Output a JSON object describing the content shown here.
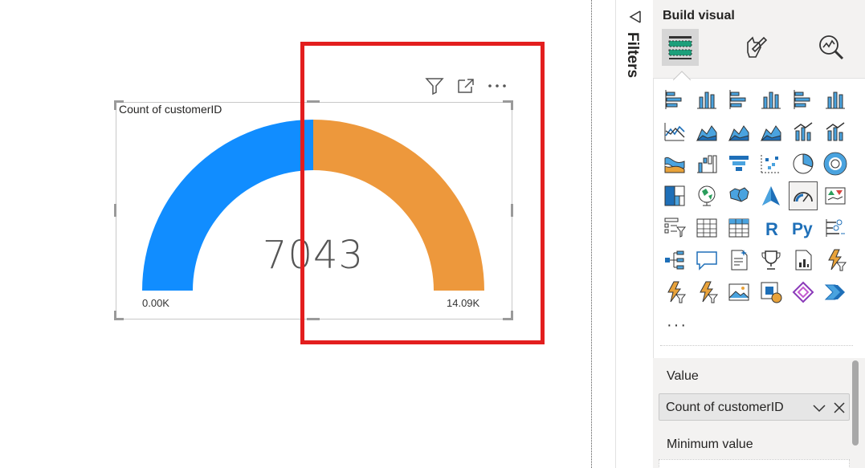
{
  "visual": {
    "title": "Count of customerID",
    "value": "7043",
    "min_label": "0.00K",
    "max_label": "14.09K",
    "value_fraction": 0.5,
    "fill_color": "#118dff",
    "target_color": "#ed983c"
  },
  "visual_header": {
    "icons": [
      "filter-icon",
      "focus-mode-icon",
      "more-options-icon"
    ],
    "more_label": "···"
  },
  "highlight_color": "#e31e1e",
  "filters_pane": {
    "label": "Filters"
  },
  "build_pane": {
    "title": "Build visual",
    "tabs": [
      "build-visual-tab",
      "format-visual-tab",
      "analytics-tab"
    ],
    "more_label": "···",
    "gallery": [
      "stacked-bar-chart",
      "stacked-column-chart",
      "clustered-bar-chart",
      "clustered-column-chart",
      "100-stacked-bar-chart",
      "100-stacked-column-chart",
      "line-chart",
      "area-chart",
      "stacked-area-chart",
      "100-stacked-area-chart",
      "line-and-stacked-column-chart",
      "line-and-clustered-column-chart",
      "ribbon-chart",
      "waterfall-chart",
      "funnel",
      "scatter-chart",
      "pie-chart",
      "donut-chart",
      "treemap",
      "map",
      "filled-map",
      "azure-map",
      "gauge",
      "kpi",
      "slicer",
      "table",
      "matrix",
      "r-script-visual",
      "python-visual",
      "key-influencers",
      "decomposition-tree",
      "qa",
      "smart-narrative",
      "metrics",
      "paginated-report",
      "power-automate",
      "power-apps",
      "power-automate-flow",
      "image-visual",
      "custom-visual",
      "power-apps-visual",
      "power-automate-visual"
    ],
    "selected_gallery_item": "gauge",
    "wells": {
      "value_label": "Value",
      "value_field": "Count of customerID",
      "min_label": "Minimum value"
    }
  }
}
